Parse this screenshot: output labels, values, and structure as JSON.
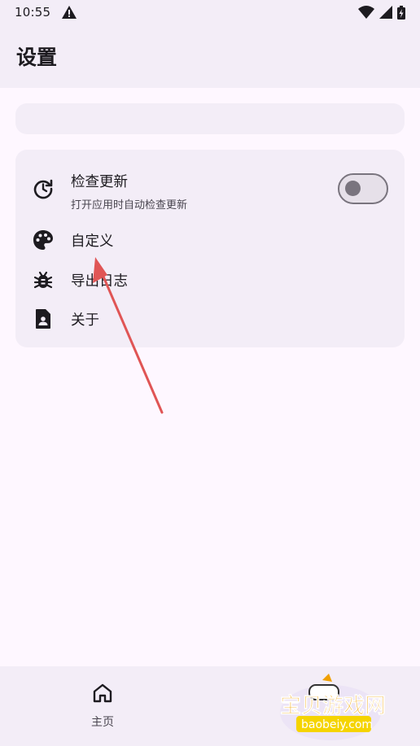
{
  "status_bar": {
    "time": "10:55",
    "icons": [
      "alert-triangle-icon",
      "wifi-icon",
      "signal-icon",
      "battery-charging-icon"
    ]
  },
  "app_bar": {
    "title": "设置"
  },
  "settings": {
    "items": [
      {
        "title": "检查更新",
        "subtitle": "打开应用时自动检查更新",
        "icon": "update-history-icon",
        "switch_on": false
      },
      {
        "title": "自定义",
        "icon": "palette-icon"
      },
      {
        "title": "导出日志",
        "icon": "bug-icon"
      },
      {
        "title": "关于",
        "icon": "document-person-icon"
      }
    ]
  },
  "bottom_nav": {
    "items": [
      {
        "label": "主页",
        "icon": "home-icon"
      }
    ]
  },
  "watermark": {
    "title": "宝贝游戏网",
    "url": "baobeiy.com"
  },
  "colors": {
    "background": "#fef7ff",
    "surface": "#f3edf7",
    "outline": "#79747e",
    "annotation": "#e05555",
    "watermark_text": "#f0a000"
  }
}
